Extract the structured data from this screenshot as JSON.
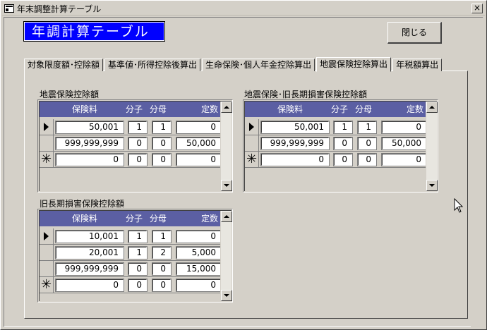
{
  "window": {
    "title": "年末調整計算テーブル",
    "close_glyph": "×"
  },
  "form": {
    "heading": "年調計算テーブル",
    "close_button": "閉じる"
  },
  "tabs": [
    {
      "label": "対象限度額･控除額",
      "active": false
    },
    {
      "label": "基準値･所得控除後算出",
      "active": false
    },
    {
      "label": "生命保険･個人年金控除算出",
      "active": false
    },
    {
      "label": "地震保険控除算出",
      "active": true
    },
    {
      "label": "年税額算出",
      "active": false
    }
  ],
  "columns": {
    "premium": "保険料",
    "numerator": "分子",
    "denominator": "分母",
    "constant": "定数"
  },
  "grids": {
    "earthquake": {
      "label": "地震保険控除額",
      "rows": [
        {
          "marker": "current",
          "premium": "50,001",
          "numerator": "1",
          "denominator": "1",
          "constant": "0"
        },
        {
          "marker": "",
          "premium": "999,999,999",
          "numerator": "0",
          "denominator": "0",
          "constant": "50,000"
        },
        {
          "marker": "new",
          "premium": "0",
          "numerator": "0",
          "denominator": "0",
          "constant": "0"
        }
      ]
    },
    "combined": {
      "label": "地震保険･旧長期損害保険控除額",
      "rows": [
        {
          "marker": "current",
          "premium": "50,001",
          "numerator": "1",
          "denominator": "1",
          "constant": "0"
        },
        {
          "marker": "",
          "premium": "999,999,999",
          "numerator": "0",
          "denominator": "0",
          "constant": "50,000"
        },
        {
          "marker": "new",
          "premium": "0",
          "numerator": "0",
          "denominator": "0",
          "constant": "0"
        }
      ]
    },
    "longterm": {
      "label": "旧長期損害保険控除額",
      "rows": [
        {
          "marker": "current",
          "premium": "10,001",
          "numerator": "1",
          "denominator": "1",
          "constant": "0"
        },
        {
          "marker": "",
          "premium": "20,001",
          "numerator": "1",
          "denominator": "2",
          "constant": "5,000"
        },
        {
          "marker": "",
          "premium": "999,999,999",
          "numerator": "0",
          "denominator": "0",
          "constant": "15,000"
        },
        {
          "marker": "new",
          "premium": "0",
          "numerator": "0",
          "denominator": "0",
          "constant": "0"
        }
      ]
    }
  },
  "new_record_glyph": "✳"
}
